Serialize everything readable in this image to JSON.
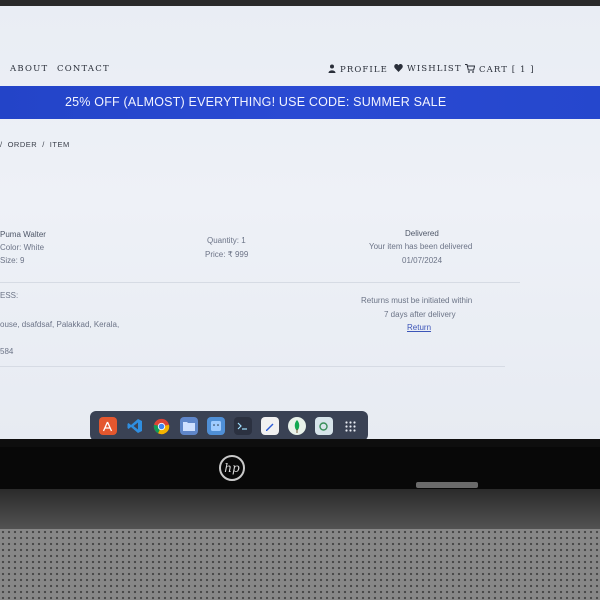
{
  "nav": {
    "about": "ABOUT",
    "contact": "CONTACT",
    "profile": "PROFILE",
    "wishlist": "WISHLIST",
    "cart": "CART [ 1 ]",
    "icons": {
      "profile": "user-icon",
      "wishlist": "heart-icon",
      "cart": "cart-icon"
    }
  },
  "banner": {
    "text": "25% OFF (ALMOST) EVERYTHING! USE CODE: SUMMER SALE",
    "color": "#2747cf"
  },
  "breadcrumb": {
    "separator_lead": "/",
    "order": "ORDER",
    "separator": "/",
    "item": "ITEM"
  },
  "item": {
    "name": "Puma Walter",
    "color": "Color: White",
    "size": "Size: 9",
    "quantity": "Quantity: 1",
    "price": "Price: ₹ 999",
    "status": "Delivered",
    "status_message": "Your item has been delivered",
    "delivered_date": "01/07/2024"
  },
  "address": {
    "label": "ESS:",
    "text": "ouse, dsafdsaf, Palakkad, Kerala,",
    "pin": "584"
  },
  "returns": {
    "policy_line1": "Returns must be initiated within",
    "policy_line2": "7 days after delivery",
    "link": "Return"
  },
  "dock": {
    "apps": [
      "app-store-icon",
      "vscode-icon",
      "chrome-icon",
      "files-icon",
      "finder-icon",
      "terminal-icon",
      "notes-icon",
      "mongodb-icon",
      "recycle-icon",
      "app-grid-icon"
    ]
  },
  "laptop": {
    "brand": "hp"
  }
}
